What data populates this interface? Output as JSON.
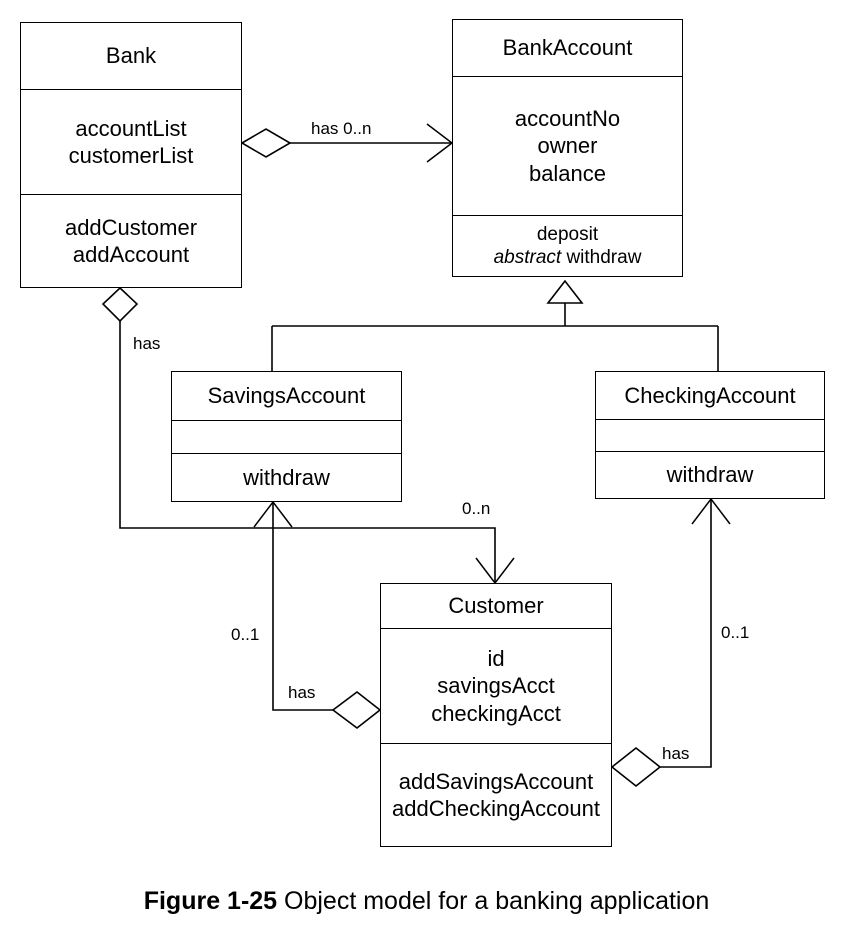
{
  "figure": {
    "caption_number": "Figure 1-25",
    "caption_text": " Object model for a banking application"
  },
  "classes": {
    "bank": {
      "name": "Bank",
      "attributes": [
        "accountList",
        "customerList"
      ],
      "methods": [
        "addCustomer",
        "addAccount"
      ]
    },
    "bank_account": {
      "name": "BankAccount",
      "attributes": [
        "accountNo",
        "owner",
        "balance"
      ],
      "methods": [
        "deposit"
      ],
      "abstract_method_keyword": "abstract",
      "abstract_method_name": " withdraw"
    },
    "savings_account": {
      "name": "SavingsAccount",
      "attributes": [],
      "methods": [
        "withdraw"
      ]
    },
    "checking_account": {
      "name": "CheckingAccount",
      "attributes": [],
      "methods": [
        "withdraw"
      ]
    },
    "customer": {
      "name": "Customer",
      "attributes": [
        "id",
        "savingsAcct",
        "checkingAcct"
      ],
      "methods": [
        "addSavingsAccount",
        "addCheckingAccount"
      ]
    }
  },
  "relationships": {
    "bank_has_accounts": {
      "label": "has 0..n",
      "from": "Bank",
      "to": "BankAccount",
      "type": "aggregation-directed"
    },
    "bank_has_customers": {
      "label": "has",
      "multiplicity": "0..n",
      "from": "Bank",
      "to": "Customer",
      "type": "aggregation-directed"
    },
    "customer_has_savings": {
      "label": "has",
      "multiplicity": "0..1",
      "from": "Customer",
      "to": "SavingsAccount",
      "type": "aggregation-directed"
    },
    "customer_has_checking": {
      "label": "has",
      "multiplicity": "0..1",
      "from": "Customer",
      "to": "CheckingAccount",
      "type": "aggregation-directed"
    },
    "savings_inherits": {
      "from": "SavingsAccount",
      "to": "BankAccount",
      "type": "generalization"
    },
    "checking_inherits": {
      "from": "CheckingAccount",
      "to": "BankAccount",
      "type": "generalization"
    }
  },
  "edge_labels": {
    "has_0n_bank_account": "has 0..n",
    "has_bank_customer": "has",
    "mult_bank_customer": "0..n",
    "has_customer_savings": "has",
    "mult_customer_savings": "0..1",
    "has_customer_checking": "has",
    "mult_customer_checking": "0..1"
  },
  "colors": {
    "stroke": "#000000",
    "fill": "#ffffff",
    "text": "#000000"
  }
}
